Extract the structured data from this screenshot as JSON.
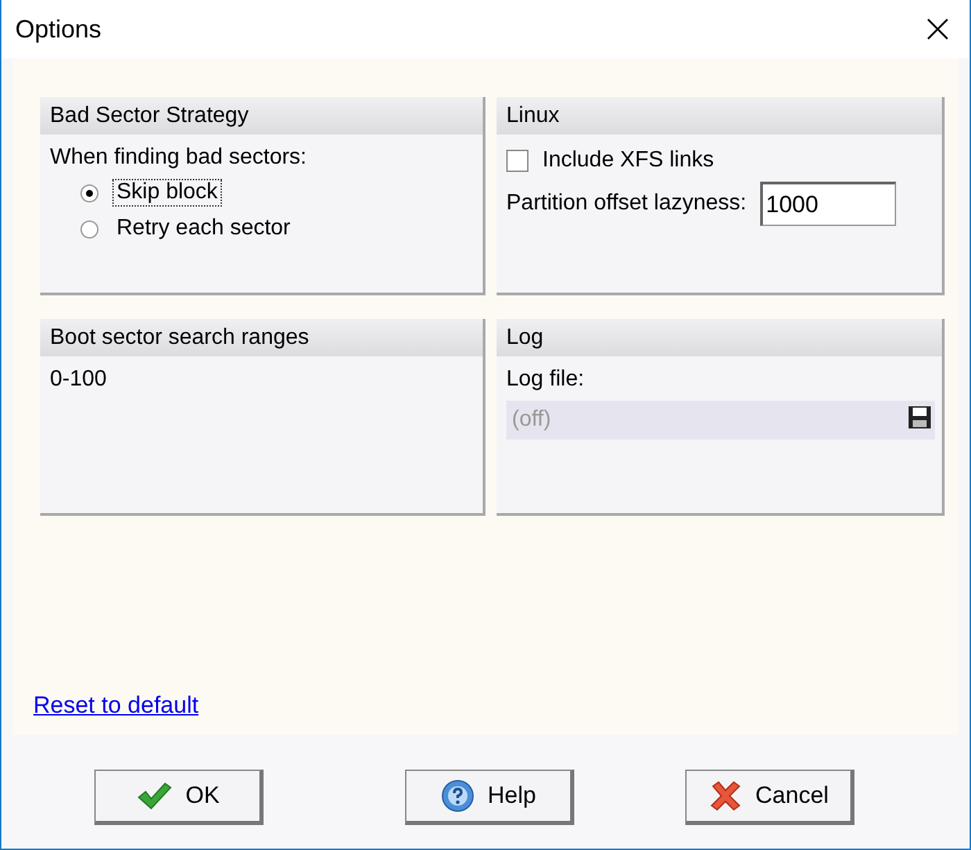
{
  "window": {
    "title": "Options"
  },
  "bad_sector_strategy": {
    "title": "Bad Sector Strategy",
    "prompt": "When finding bad sectors:",
    "options": [
      {
        "label": "Skip block",
        "selected": true,
        "focused": true
      },
      {
        "label": "Retry each sector",
        "selected": false,
        "focused": false
      }
    ]
  },
  "linux": {
    "title": "Linux",
    "include_xfs_links": {
      "label": "Include XFS links",
      "checked": false
    },
    "partition_offset": {
      "label": "Partition offset lazyness:",
      "value": "1000"
    }
  },
  "boot_sector_search_ranges": {
    "title": "Boot sector search ranges",
    "ranges": "0-100"
  },
  "log": {
    "title": "Log",
    "label": "Log file:",
    "value": "(off)",
    "disabled": true
  },
  "reset_link": "Reset to default",
  "buttons": [
    {
      "label": "OK",
      "kind": "ok"
    },
    {
      "label": "Help",
      "kind": "help"
    },
    {
      "label": "Cancel",
      "kind": "cancel"
    }
  ]
}
